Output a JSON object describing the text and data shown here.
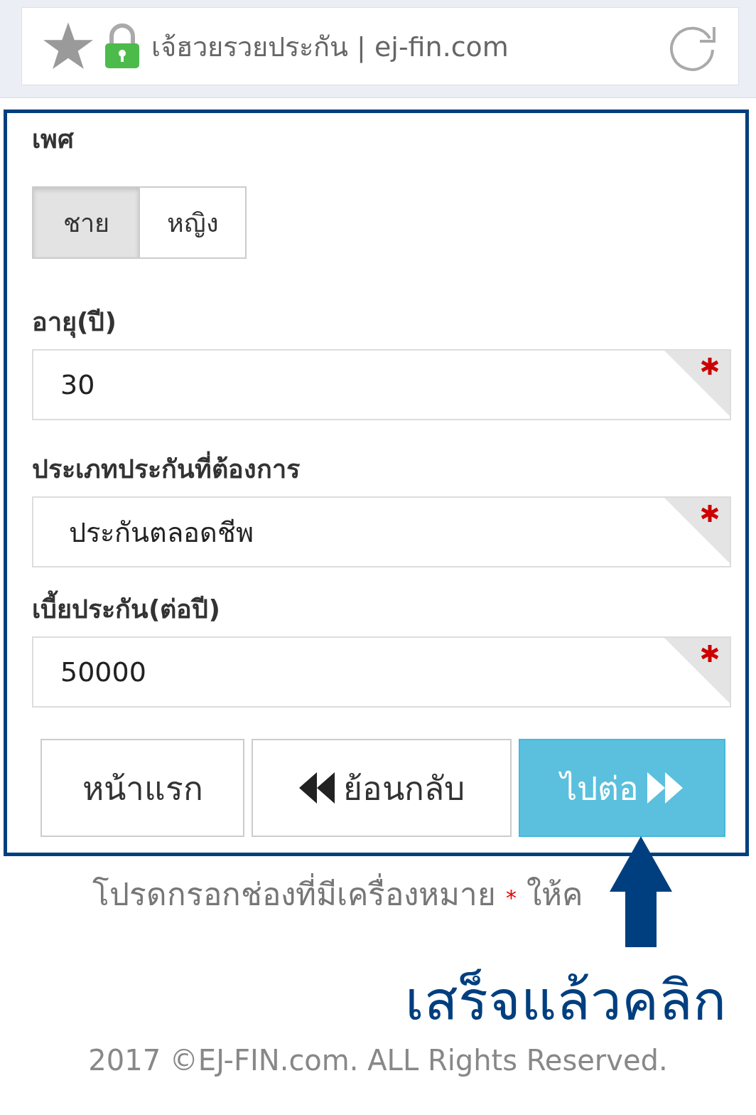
{
  "address_bar": {
    "title": "เจ้ฮวยรวยประกัน | ej-fin.com"
  },
  "form": {
    "gender": {
      "label": "เพศ",
      "options": [
        {
          "label": "ชาย",
          "selected": true
        },
        {
          "label": "หญิง",
          "selected": false
        }
      ]
    },
    "fields": [
      {
        "label": "อายุ(ปี)",
        "value": "30",
        "required": true
      },
      {
        "label": "ประเภทประกันที่ต้องการ",
        "value": "ประกันตลอดชีพ",
        "required": true
      },
      {
        "label": "เบี้ยประกัน(ต่อปี)",
        "value": "50000",
        "required": true
      }
    ],
    "buttons": [
      {
        "label": "หน้าแรก",
        "kind": "home"
      },
      {
        "label": "ย้อนกลับ",
        "kind": "back"
      },
      {
        "label": "ไปต่อ",
        "kind": "next"
      }
    ]
  },
  "hint": {
    "text": "โปรดกรอกช่องที่มีเครื่องหมาย",
    "mark": "*",
    "rest": "ให้ค"
  },
  "callout": "เสร็จแล้วคลิก",
  "footer": "2017 ©EJ-FIN.com. ALL Rights Reserved."
}
